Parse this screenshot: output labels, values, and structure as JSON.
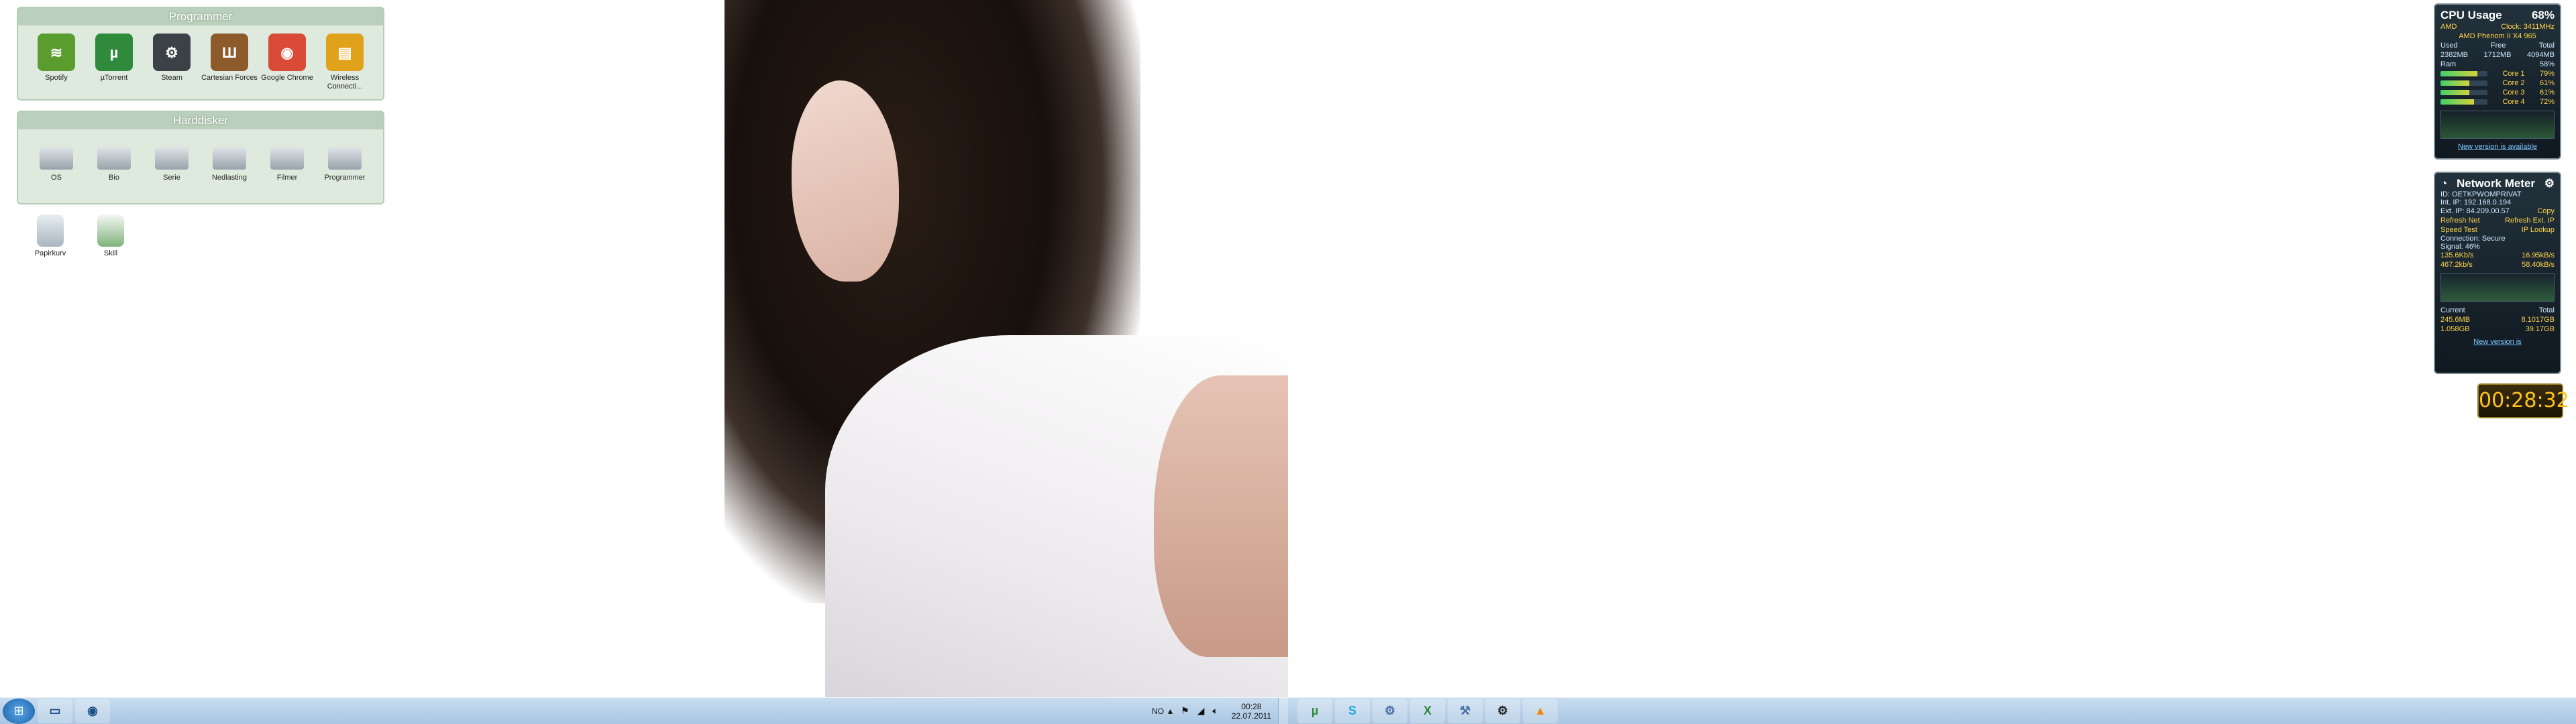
{
  "fences": [
    {
      "title": "Programmer",
      "items": [
        {
          "label": "Spotify",
          "icon": "spotify-icon",
          "color": "#5a9c2e",
          "glyph": "≋"
        },
        {
          "label": "µTorrent",
          "icon": "utorrent-icon",
          "color": "#2f8a3c",
          "glyph": "µ"
        },
        {
          "label": "Steam",
          "icon": "steam-icon",
          "color": "#3b4147",
          "glyph": "⚙"
        },
        {
          "label": "Cartesian Forces",
          "icon": "game-icon",
          "color": "#8c5a2b",
          "glyph": "Ш"
        },
        {
          "label": "Google Chrome",
          "icon": "chrome-icon",
          "color": "#d94b36",
          "glyph": "◉"
        },
        {
          "label": "Wireless Connecti...",
          "icon": "dlink-icon",
          "color": "#e0a21b",
          "glyph": "▤"
        }
      ]
    },
    {
      "title": "Harddisker",
      "items": [
        {
          "label": "OS",
          "icon": "drive-icon"
        },
        {
          "label": "Bio",
          "icon": "drive-icon"
        },
        {
          "label": "Serie",
          "icon": "drive-icon"
        },
        {
          "label": "Nedlasting",
          "icon": "drive-icon"
        },
        {
          "label": "Filmer",
          "icon": "drive-icon"
        },
        {
          "label": "Programmer",
          "icon": "drive-icon"
        }
      ]
    }
  ],
  "loose_icons": [
    {
      "label": "Papirkurv",
      "icon": "recycle-bin-icon"
    },
    {
      "label": "Skill",
      "icon": "excel-file-icon"
    }
  ],
  "cpu_gadget": {
    "title": "CPU Usage",
    "percent": "68%",
    "brand": "AMD",
    "clock": "Clock: 3411MHz",
    "model": "AMD Phenom II X4 965",
    "headers": [
      "Used",
      "Free",
      "Total"
    ],
    "mem": [
      "2382MB",
      "1712MB",
      "4094MB"
    ],
    "ram": "Ram",
    "ram_pct": "58%",
    "cores": [
      {
        "label": "Core 1",
        "pct": "79%",
        "level": 0.79
      },
      {
        "label": "Core 2",
        "pct": "61%",
        "level": 0.61
      },
      {
        "label": "Core 3",
        "pct": "61%",
        "level": 0.61
      },
      {
        "label": "Core 4",
        "pct": "72%",
        "level": 0.72
      }
    ],
    "link": "New version is available"
  },
  "net_gadget": {
    "title": "Network Meter",
    "id": "ID: OETKPWOMPRIVAT",
    "int_ip": "Int. IP: 192.168.0.194",
    "ext_ip": "Ext. IP: 84.209.00.57",
    "copy": "Copy",
    "refresh_net": "Refresh Net",
    "refresh_ext": "Refresh Ext. IP",
    "speed_test": "Speed Test",
    "ip_lookup": "IP Lookup",
    "connection": "Connection: Secure",
    "signal": "Signal: 46%",
    "up_rate": "135.6Kb/s",
    "up_rate2": "16.95kB/s",
    "down_rate": "467.2kb/s",
    "down_rate2": "58.40kB/s",
    "current": "Current",
    "total": "Total",
    "cur_up": "245.6MB",
    "cur_down": "1.058GB",
    "tot_up": "8.1017GB",
    "tot_down": "39.17GB",
    "link": "New version is"
  },
  "clock_gadget": {
    "time": "00:28:32"
  },
  "taskbar_left": {
    "pinned": [
      {
        "icon": "explorer-folder-icon",
        "glyph": "▭"
      },
      {
        "icon": "chrome-icon",
        "glyph": "◉"
      }
    ],
    "tray": {
      "lang": "NO",
      "time": "00:28",
      "date": "22.07.2011"
    }
  },
  "taskbar_right": {
    "pinned": [
      {
        "icon": "utorrent-icon",
        "glyph": "µ",
        "color": "#2f8a3c"
      },
      {
        "icon": "skype-icon",
        "glyph": "S",
        "color": "#1fa7e1"
      },
      {
        "icon": "settings-icon",
        "glyph": "⚙",
        "color": "#4a6fa5"
      },
      {
        "icon": "excel-icon",
        "glyph": "X",
        "color": "#2f8a3c"
      },
      {
        "icon": "tool-icon",
        "glyph": "⚒",
        "color": "#4a6fa5"
      },
      {
        "icon": "steam-icon",
        "glyph": "⚙",
        "color": "#222"
      },
      {
        "icon": "vlc-icon",
        "glyph": "▲",
        "color": "#f08a00"
      }
    ]
  }
}
